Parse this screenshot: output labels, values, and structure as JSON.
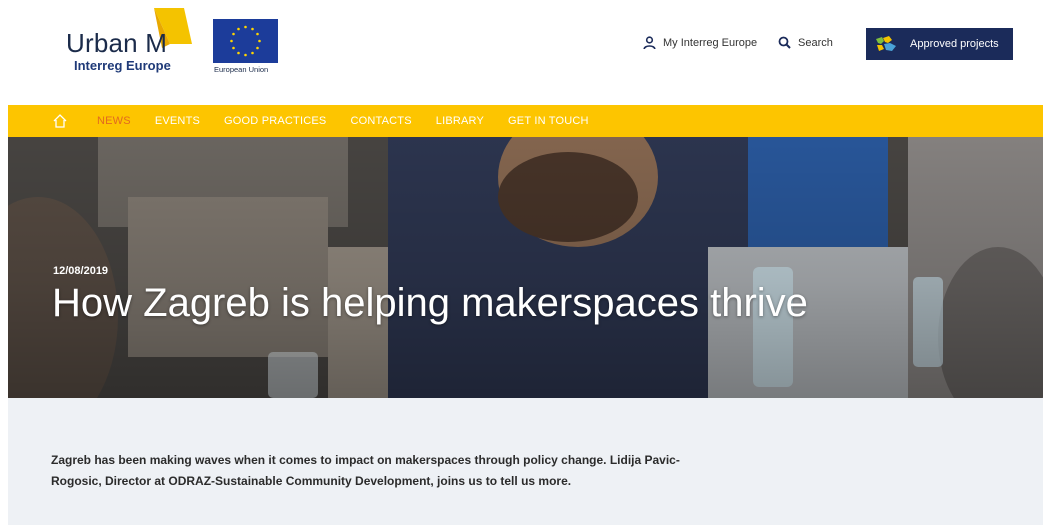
{
  "header": {
    "logo": {
      "title": "Urban M",
      "subtitle": "Interreg Europe"
    },
    "eu_label": "European Union",
    "my_interreg": {
      "label": "My Interreg Europe",
      "icon": "user-icon"
    },
    "search": {
      "label": "Search",
      "icon": "search-icon"
    },
    "approved_projects": {
      "label": "Approved projects",
      "icon": "map-icon"
    }
  },
  "nav": {
    "home_icon": "home-icon",
    "items": [
      {
        "label": "NEWS",
        "active": true
      },
      {
        "label": "EVENTS"
      },
      {
        "label": "GOOD PRACTICES"
      },
      {
        "label": "CONTACTS"
      },
      {
        "label": "LIBRARY"
      },
      {
        "label": "GET IN TOUCH"
      }
    ]
  },
  "hero": {
    "date": "12/08/2019",
    "title": "How Zagreb is helping makerspaces thrive"
  },
  "intro": {
    "text": "Zagreb has been making waves when it comes to impact on makerspaces through policy change. Lidija Pavic-Rogosic, Director at ODRAZ-Sustainable Community Development, joins us to tell us more."
  },
  "colors": {
    "nav_bg": "#fdc500",
    "nav_active": "#e26a1f",
    "brand_navy": "#1b2b5a",
    "intro_bg": "#eef1f5"
  }
}
